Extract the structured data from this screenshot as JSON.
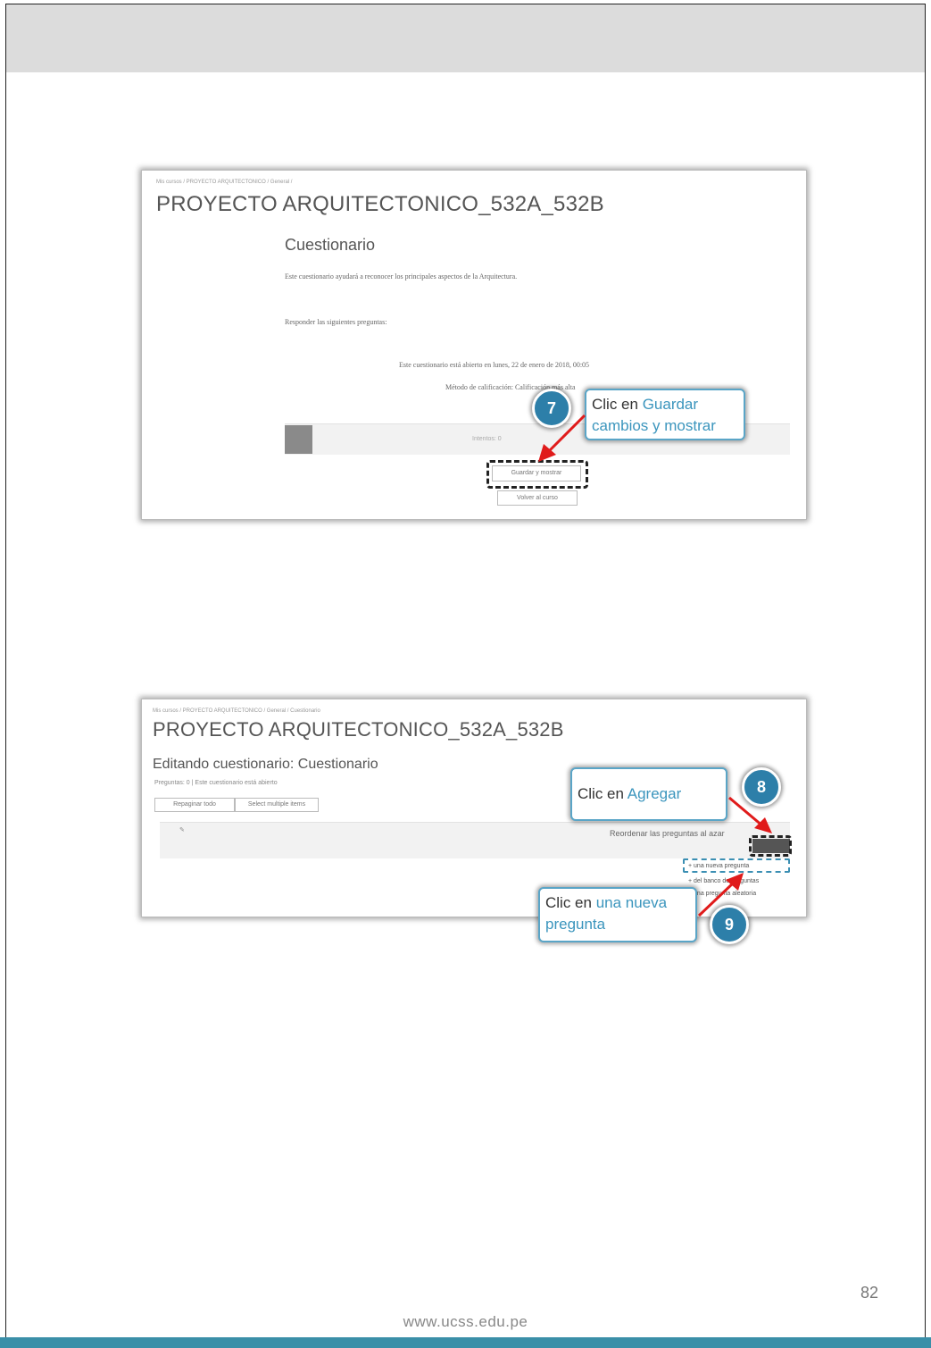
{
  "page": {
    "page_number": "82",
    "footer_url": "www.ucss.edu.pe"
  },
  "shot1": {
    "breadcrumb": "Mis cursos / PROYECTO ARQUITECTONICO / General /",
    "course_title": "PROYECTO ARQUITECTONICO_532A_532B",
    "quiz_title": "Cuestionario",
    "intro": "Este cuestionario ayudará a reconocer los principales aspectos de la Arquitectura.",
    "instruction": "Responder las siguientes preguntas:",
    "open_notice": "Este cuestionario está abierto en lunes, 22 de enero de 2018, 00:05",
    "grading_method": "Método de calificación: Calificación más alta",
    "bar_text": "Intentos: 0",
    "save_button": "Guardar y mostrar",
    "cancel_button": "Volver al curso",
    "callout": {
      "prefix": "Clic en ",
      "highlight": "Guardar cambios y mostrar"
    },
    "step": "7"
  },
  "shot2": {
    "breadcrumb": "Mis cursos / PROYECTO ARQUITECTONICO / General / Cuestionario",
    "course_title": "PROYECTO ARQUITECTONICO_532A_532B",
    "edit_title": "Editando cuestionario: Cuestionario",
    "questions_info": "Preguntas: 0 | Este cuestionario está abierto",
    "repaginate_button": "Repaginar todo",
    "select_button": "Select multiple items",
    "reorder_text": "Reordenar las preguntas al azar",
    "menu_items": [
      "+ una nueva pregunta",
      "+ del banco de preguntas",
      "+ una pregunta aleatoria"
    ],
    "callout_add": {
      "prefix": "Clic en ",
      "highlight": "Agregar"
    },
    "callout_new": {
      "prefix": "Clic en ",
      "highlight": "una nueva pregunta"
    },
    "step_add": "8",
    "step_new": "9"
  },
  "colors": {
    "accent": "#3b95bd",
    "badge": "#2d7fa9",
    "arrow": "#e01b1b",
    "bottom_band": "#3a8fa8",
    "top_band": "#dcdcdc"
  }
}
